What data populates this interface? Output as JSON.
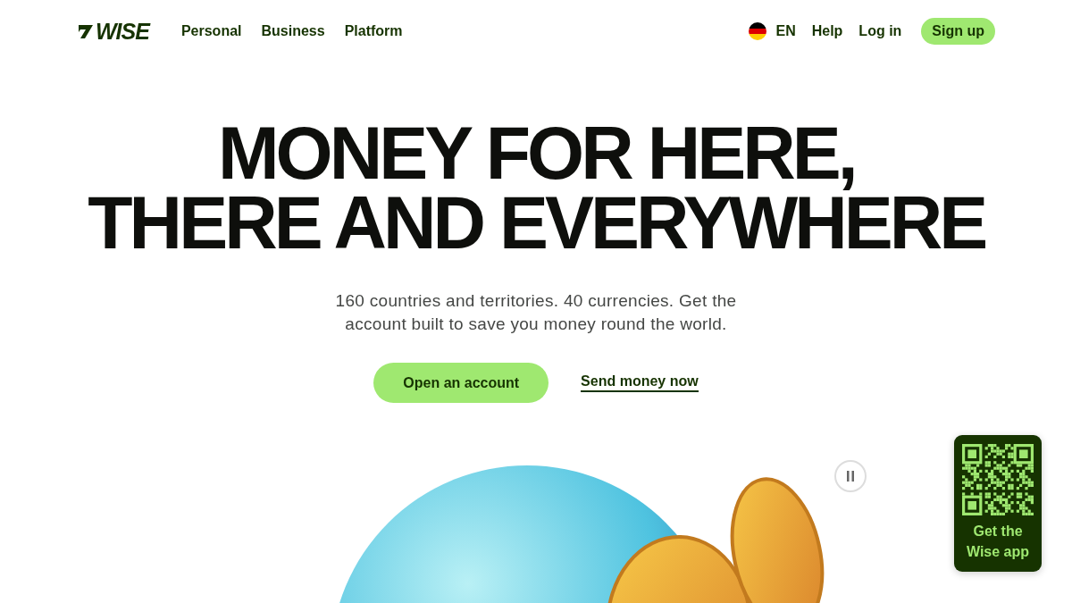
{
  "header": {
    "logo": "WISE",
    "nav": [
      {
        "label": "Personal"
      },
      {
        "label": "Business"
      },
      {
        "label": "Platform"
      }
    ],
    "language": "EN",
    "links": [
      {
        "label": "Help"
      },
      {
        "label": "Log in"
      }
    ],
    "signup": "Sign up"
  },
  "hero": {
    "headline": [
      "MONEY FOR HERE,",
      "THERE AND EVERYWHERE"
    ],
    "subtitle": "160 countries and territories. 40 currencies. Get the account built to save you money round the world.",
    "primary_button": "Open an account",
    "secondary_link": "Send money now"
  },
  "app_card": {
    "label": "Get the Wise app"
  }
}
